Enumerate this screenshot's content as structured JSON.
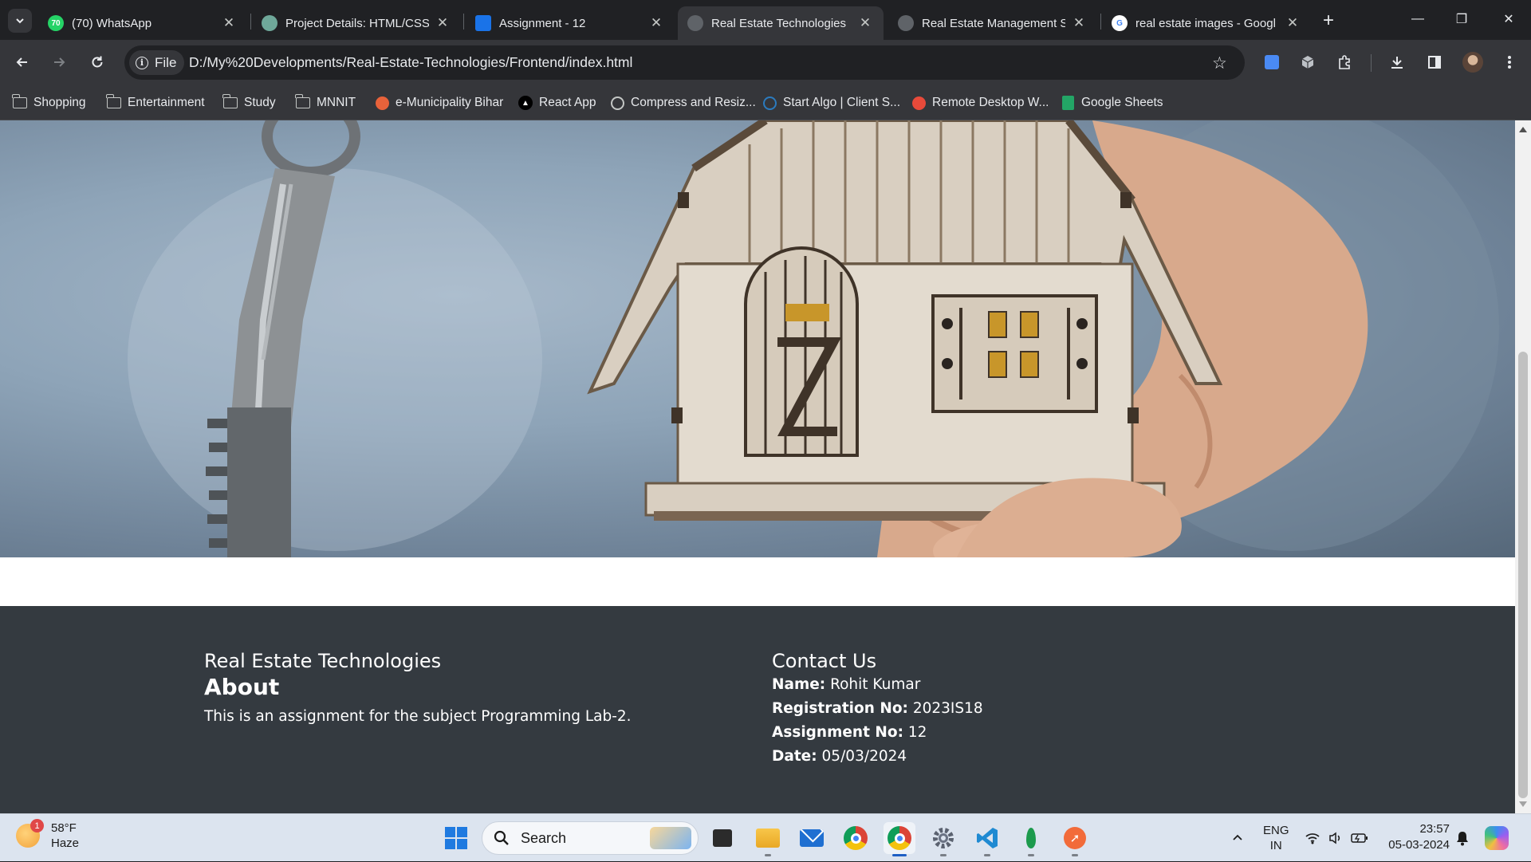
{
  "browser": {
    "tabs": [
      {
        "title": "(70) WhatsApp",
        "favicon": "whatsapp-icon",
        "favicon_text": "70",
        "active": false
      },
      {
        "title": "Project Details: HTML/CSS/",
        "favicon": "chatgpt-icon",
        "active": false
      },
      {
        "title": "Assignment - 12",
        "favicon": "classroom-icon",
        "active": false
      },
      {
        "title": "Real Estate Technologies",
        "favicon": "globe-icon",
        "active": true
      },
      {
        "title": "Real Estate Management S",
        "favicon": "globe-icon",
        "active": false
      },
      {
        "title": "real estate images - Googl",
        "favicon": "google-icon",
        "active": false
      }
    ],
    "new_tab_label": "+",
    "address": {
      "scheme_label": "File",
      "url": "D:/My%20Developments/Real-Estate-Technologies/Frontend/index.html"
    },
    "bookmarks": [
      {
        "label": "Shopping",
        "icon": "folder-icon"
      },
      {
        "label": "Entertainment",
        "icon": "folder-icon"
      },
      {
        "label": "Study",
        "icon": "folder-icon"
      },
      {
        "label": "MNNIT",
        "icon": "folder-icon"
      },
      {
        "label": "e-Municipality Bihar",
        "icon": "municipality-icon"
      },
      {
        "label": "React App",
        "icon": "react-app-icon"
      },
      {
        "label": "Compress and Resiz...",
        "icon": "globe-icon"
      },
      {
        "label": "Start Algo | Client S...",
        "icon": "startalgo-icon"
      },
      {
        "label": "Remote Desktop W...",
        "icon": "remote-desktop-icon"
      },
      {
        "label": "Google Sheets",
        "icon": "sheets-icon"
      }
    ]
  },
  "page": {
    "hero_image": "house-and-keys-photo",
    "footer": {
      "brand": "Real Estate Technologies",
      "about_heading": "About",
      "about_text": "This is an assignment for the subject Programming Lab-2.",
      "contact_heading": "Contact Us",
      "contact": [
        {
          "label": "Name:",
          "value": "Rohit Kumar"
        },
        {
          "label": "Registration No:",
          "value": "2023IS18"
        },
        {
          "label": "Assignment No:",
          "value": "12"
        },
        {
          "label": "Date:",
          "value": "05/03/2024"
        }
      ]
    }
  },
  "taskbar": {
    "weather": {
      "temp": "58°F",
      "condition": "Haze",
      "badge": "1"
    },
    "search_placeholder": "Search",
    "tray": {
      "lang_top": "ENG",
      "lang_bottom": "IN"
    },
    "clock": {
      "time": "23:57",
      "date": "05-03-2024"
    }
  },
  "colors": {
    "footer_bg": "#343a40",
    "chrome_bg": "#202124",
    "toolbar_bg": "#35363a",
    "taskbar_bg": "#dce4ef"
  }
}
